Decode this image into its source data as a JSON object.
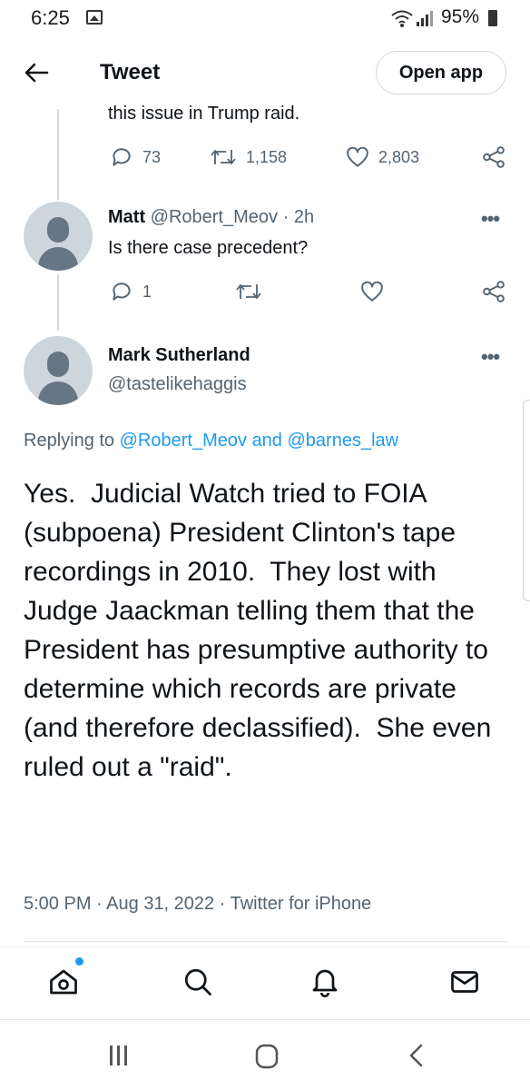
{
  "status_bar": {
    "time": "6:25",
    "battery": "95%",
    "icons": [
      "gallery-icon",
      "wifi-icon",
      "signal-icon",
      "battery-icon"
    ]
  },
  "header": {
    "title": "Tweet",
    "open_app_label": "Open app",
    "back_icon": "arrow-left-icon"
  },
  "previous_tweet": {
    "clipped_text": "this issue in Trump raid.",
    "replies": "73",
    "retweets": "1,158",
    "likes": "2,803"
  },
  "reply_tweet": {
    "name": "Matt",
    "handle": "@Robert_Meov",
    "separator": "·",
    "time": "2h",
    "text": "Is there case precedent?",
    "replies": "1"
  },
  "main_tweet": {
    "name": "Mark Sutherland",
    "handle": "@tastelikehaggis",
    "replying_prefix": "Replying to",
    "replying_user_1": "@Robert_Meov",
    "replying_and": "and",
    "replying_user_2": "@barnes_law",
    "text": "Yes.  Judicial Watch tried to FOIA (subpoena) President Clinton's tape recordings in 2010.  They lost with Judge Jaackman telling them that the President has presumptive authority to determine which records are private (and therefore declassified).  She even ruled out a \"raid\".",
    "time": "5:00 PM",
    "date": "Aug 31, 2022",
    "source": "Twitter for iPhone",
    "dot": "·"
  },
  "bottom_nav": [
    "home-icon",
    "search-icon",
    "notifications-icon",
    "messages-icon"
  ],
  "colors": {
    "accent": "#1d9bf0",
    "secondary_text": "#536471",
    "primary_text": "#0f1419",
    "avatar_bg": "#cdd6dd"
  }
}
